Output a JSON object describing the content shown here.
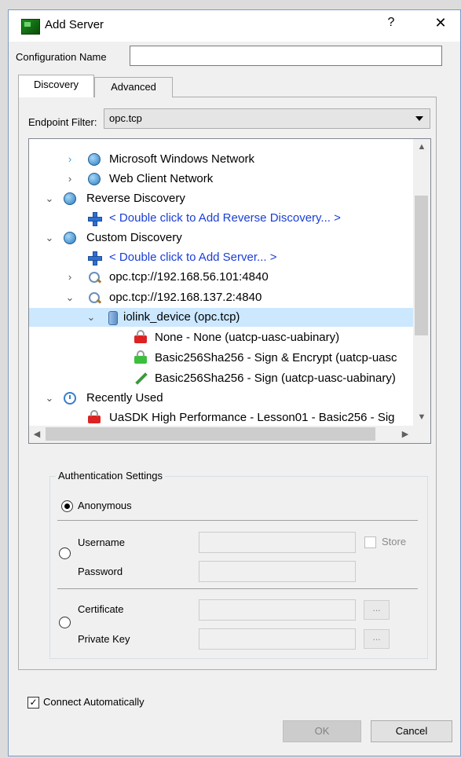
{
  "window": {
    "title": "Add Server",
    "help": "?",
    "close": "✕"
  },
  "config": {
    "label": "Configuration Name",
    "value": ""
  },
  "tabs": [
    {
      "label": "Discovery"
    },
    {
      "label": "Advanced"
    }
  ],
  "endpoint_filter": {
    "label": "Endpoint Filter:",
    "value": "opc.tcp"
  },
  "tree": [
    {
      "text": "Microsoft Windows Network",
      "icon": "globe-icon",
      "arrow": "›",
      "link": false
    },
    {
      "text": "Web Client Network",
      "icon": "globe-icon",
      "arrow": "›",
      "link": false
    },
    {
      "text": "Reverse Discovery",
      "icon": "globe-icon",
      "arrow": "⌄",
      "link": false
    },
    {
      "text": "< Double click to Add Reverse Discovery... >",
      "icon": "plus-icon",
      "arrow": "",
      "link": true
    },
    {
      "text": "Custom Discovery",
      "icon": "globe-icon",
      "arrow": "⌄",
      "link": false
    },
    {
      "text": "< Double click to Add Server... >",
      "icon": "plus-icon",
      "arrow": "",
      "link": true
    },
    {
      "text": "opc.tcp://192.168.56.101:4840",
      "icon": "search-icon",
      "arrow": "›",
      "link": false
    },
    {
      "text": "opc.tcp://192.168.137.2:4840",
      "icon": "search-icon",
      "arrow": "⌄",
      "link": false
    },
    {
      "text": "iolink_device (opc.tcp)",
      "icon": "device-icon",
      "arrow": "⌄",
      "link": false
    },
    {
      "text": "None - None (uatcp-uasc-uabinary)",
      "icon": "red-lock-icon",
      "arrow": "",
      "link": false
    },
    {
      "text": "Basic256Sha256 - Sign & Encrypt (uatcp-uasc",
      "icon": "green-lock-icon",
      "arrow": "",
      "link": false
    },
    {
      "text": "Basic256Sha256 - Sign (uatcp-uasc-uabinary)",
      "icon": "pencil-icon",
      "arrow": "",
      "link": false
    },
    {
      "text": "Recently Used",
      "icon": "clock-icon",
      "arrow": "⌄",
      "link": false
    },
    {
      "text": "UaSDK High Performance - Lesson01 - Basic256 - Sig",
      "icon": "red-lock-icon",
      "arrow": "",
      "link": false
    }
  ],
  "auth": {
    "title": "Authentication Settings",
    "anonymous": "Anonymous",
    "username": "Username",
    "password": "Password",
    "store": "Store",
    "certificate": "Certificate",
    "private_key": "Private Key",
    "browse": "..."
  },
  "connect_automatically": "Connect Automatically",
  "buttons": {
    "ok": "OK",
    "cancel": "Cancel"
  }
}
